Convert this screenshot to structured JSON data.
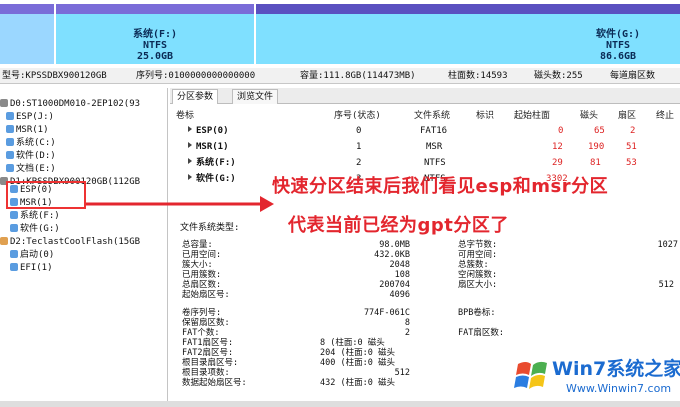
{
  "diskmap": {
    "partitions": [
      {
        "name": "系统(F:)",
        "fs": "NTFS",
        "size": "25.0GB"
      },
      {
        "name": "软件(G:)",
        "fs": "NTFS",
        "size": "86.6GB"
      }
    ]
  },
  "diskinfo": {
    "model": "型号:KPSSDBX900120GB",
    "serial": "序列号:0100000000000000",
    "capacity": "容量:111.8GB(114473MB)",
    "cylinders": "柱面数:14593",
    "heads": "磁头数:255",
    "sectors_per_track": "每道扇区数"
  },
  "tree": {
    "items": [
      "D0:ST1000DM010-2EP102(93",
      "ESP(J:)",
      "MSR(1)",
      "系统(C:)",
      "软件(D:)",
      "文档(E:)",
      "D1:KPSSDBX900120GB(112GB",
      "ESP(0)",
      "MSR(1)",
      "系统(F:)",
      "软件(G:)",
      "D2:TeclastCoolFlash(15GB",
      "启动(0)",
      "EFI(1)"
    ]
  },
  "tabs": [
    "分区参数",
    "浏览文件"
  ],
  "ptable": {
    "headers": [
      "卷标",
      "序号(状态)",
      "文件系统",
      "标识",
      "起始柱面",
      "磁头",
      "扇区",
      "终止"
    ],
    "rows": [
      {
        "label": "ESP(0)",
        "num": "0",
        "fs": "FAT16",
        "flag": "",
        "start": "0",
        "head": "65",
        "sector": "2"
      },
      {
        "label": "MSR(1)",
        "num": "1",
        "fs": "MSR",
        "flag": "",
        "start": "12",
        "head": "190",
        "sector": "51"
      },
      {
        "label": "系统(F:)",
        "num": "2",
        "fs": "NTFS",
        "flag": "",
        "start": "29",
        "head": "81",
        "sector": "53"
      },
      {
        "label": "软件(G:)",
        "num": "3",
        "fs": "NTFS",
        "flag": "",
        "start": "3302",
        "head": "",
        "sector": ""
      }
    ]
  },
  "fs_label": "文件系统类型:",
  "details": {
    "left": [
      {
        "k": "总容量:",
        "v": "98.0MB"
      },
      {
        "k": "已用空间:",
        "v": "432.0KB"
      },
      {
        "k": "簇大小:",
        "v": "2048"
      },
      {
        "k": "已用簇数:",
        "v": "108"
      },
      {
        "k": "总扇区数:",
        "v": "200704"
      },
      {
        "k": "起始扇区号:",
        "v": "4096"
      },
      {
        "k": "卷序列号:",
        "v": "774F-061C"
      },
      {
        "k": "保留扇区数:",
        "v": "8"
      },
      {
        "k": "FAT个数:",
        "v": "2"
      },
      {
        "k": "FAT1扇区号:",
        "v": "8 (柱面:0 磁头"
      },
      {
        "k": "FAT2扇区号:",
        "v": "204 (柱面:0 磁头"
      },
      {
        "k": "根目录扇区号:",
        "v": "400 (柱面:0 磁头"
      },
      {
        "k": "根目录项数:",
        "v": "512"
      },
      {
        "k": "数据起始扇区号:",
        "v": "432 (柱面:0 磁头"
      }
    ],
    "right": [
      {
        "k": "总字节数:",
        "v": "1027"
      },
      {
        "k": "可用空间:",
        "v": ""
      },
      {
        "k": "总簇数:",
        "v": ""
      },
      {
        "k": "空闲簇数:",
        "v": ""
      },
      {
        "k": "扇区大小:",
        "v": "512"
      },
      {
        "k": "BPB卷标:",
        "v": ""
      },
      {
        "k": "FAT扇区数:",
        "v": ""
      }
    ]
  },
  "annotation": {
    "line1": "快速分区结束后我们看见esp和msr分区",
    "line2": "代表当前已经为gpt分区了"
  },
  "watermark": {
    "main": "Win7系统之家",
    "url": "Www.Winwin7.com"
  },
  "colors": {
    "accent_red": "#e3262e",
    "partition_fill": "#7fe0ff",
    "watermark_blue": "#1b6bd0"
  }
}
